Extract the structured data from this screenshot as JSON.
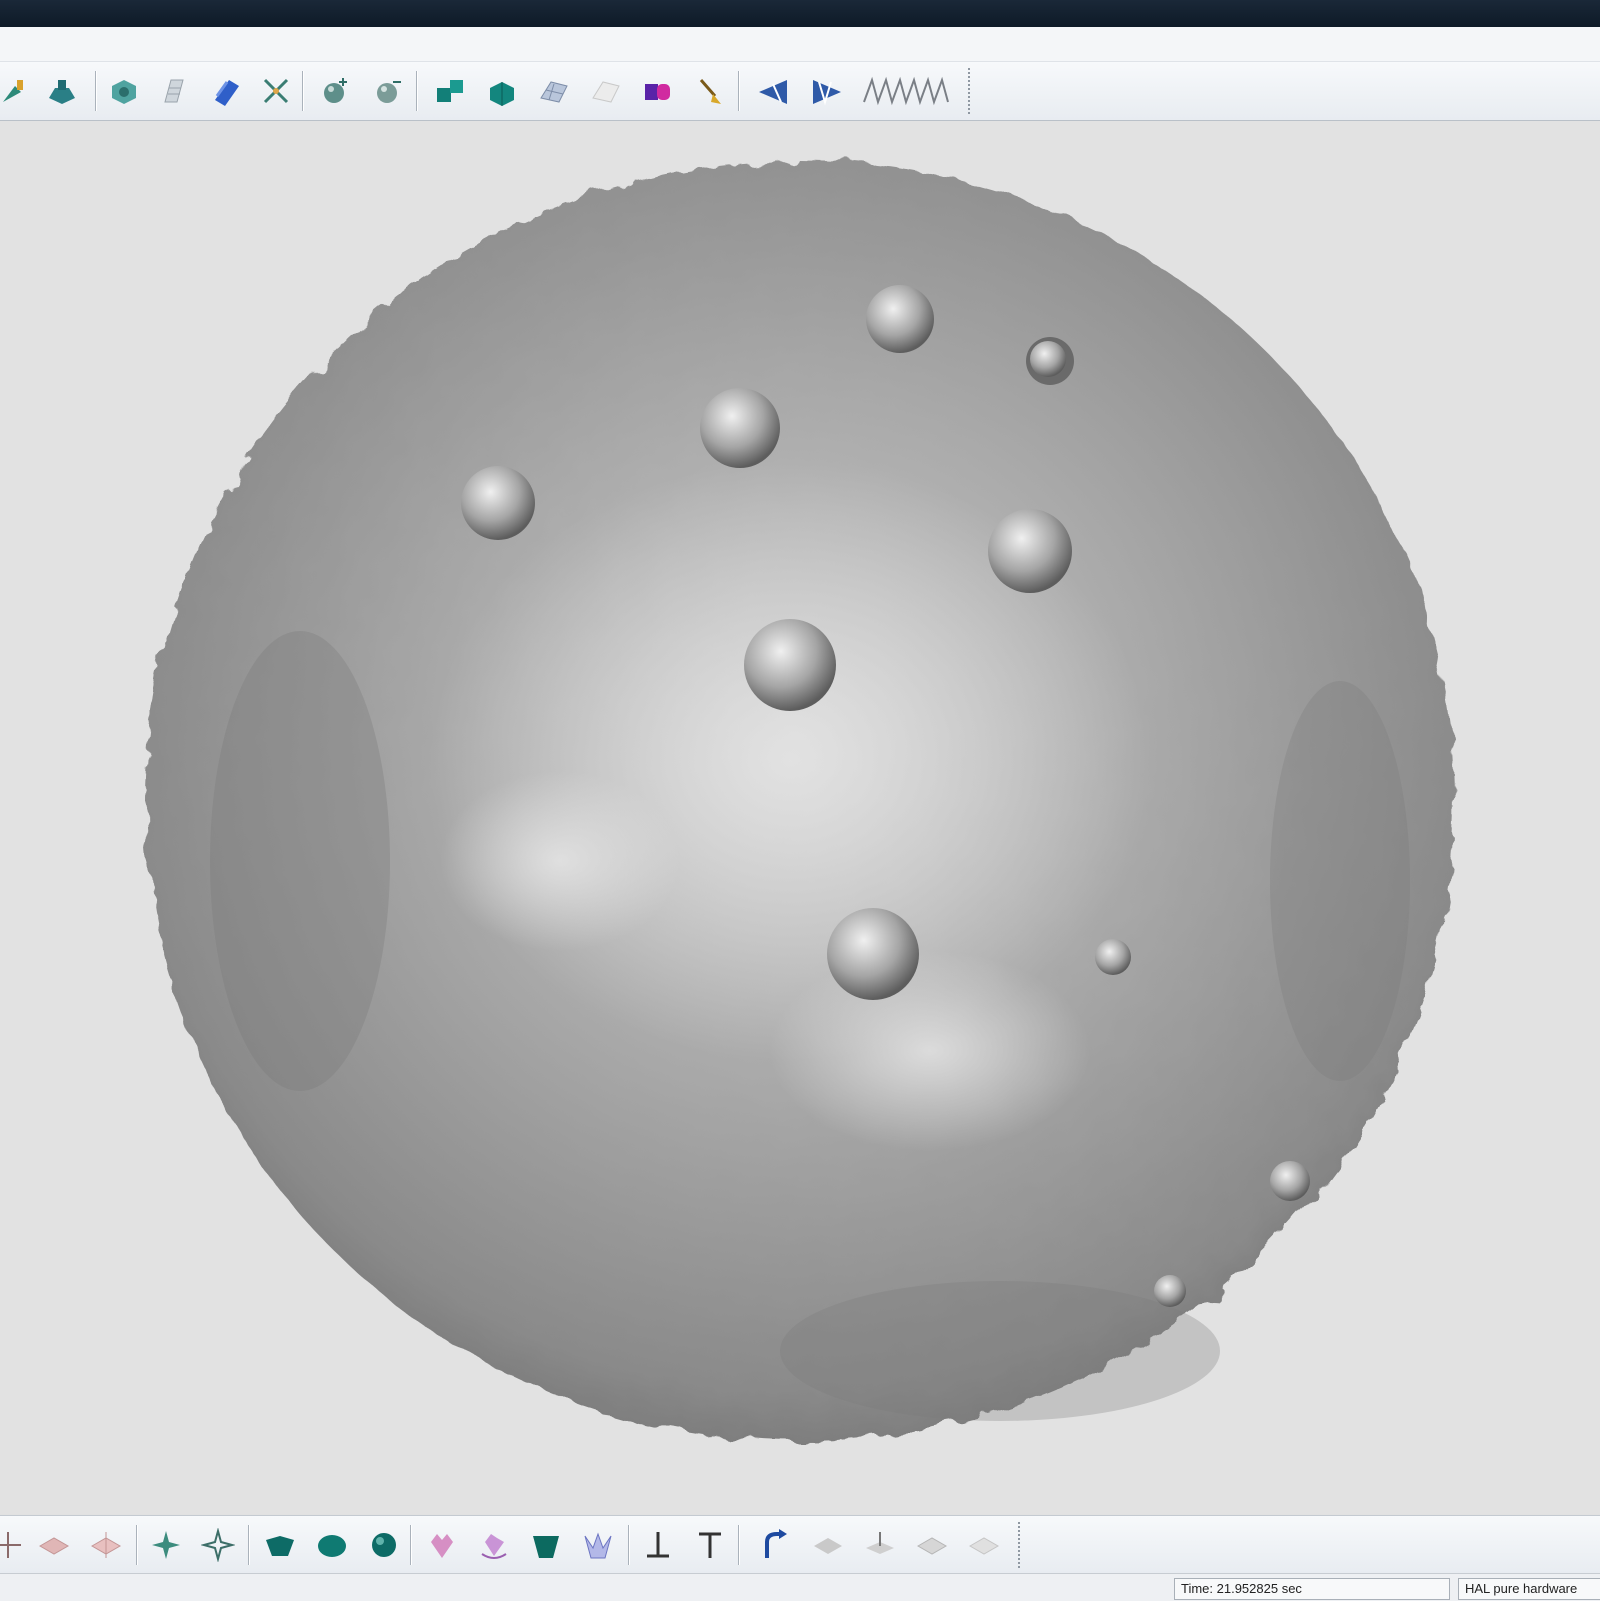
{
  "toolbar_top": {
    "icons": [
      "pipette-icon",
      "shape-icon",
      "cube-icon",
      "layers-icon",
      "ruler-icon",
      "cross-icon",
      "sphere-plus-icon",
      "sphere-minus-icon",
      "cube-pair-icon",
      "cube-rotate-icon",
      "mesh-grid-icon",
      "mesh-outline-icon",
      "color-blocks-icon",
      "brush-icon",
      "arrow-left-icon",
      "arrow-right-icon",
      "wave-icon"
    ]
  },
  "toolbar_bottom": {
    "icons": [
      "axis-icon",
      "view-front-icon",
      "view-back-icon",
      "star-view-icon",
      "star-outline-icon",
      "solid-shade-icon",
      "solid-round-icon",
      "sphere-shade-icon",
      "flower-icon",
      "flower-rotate-icon",
      "cup-icon",
      "crown-icon",
      "t-axis-down-icon",
      "t-axis-up-icon",
      "rotate-arrow-icon",
      "view-top-icon",
      "view-side-icon",
      "view-iso-icon",
      "view-bottom-icon"
    ]
  },
  "viewport": {
    "model": "sphere-mesh",
    "background_color": "#e2e2e2",
    "surface_color": "#9a9a9a"
  },
  "status": {
    "time": "Time: 21.952825 sec",
    "renderer": "HAL pure hardware"
  }
}
